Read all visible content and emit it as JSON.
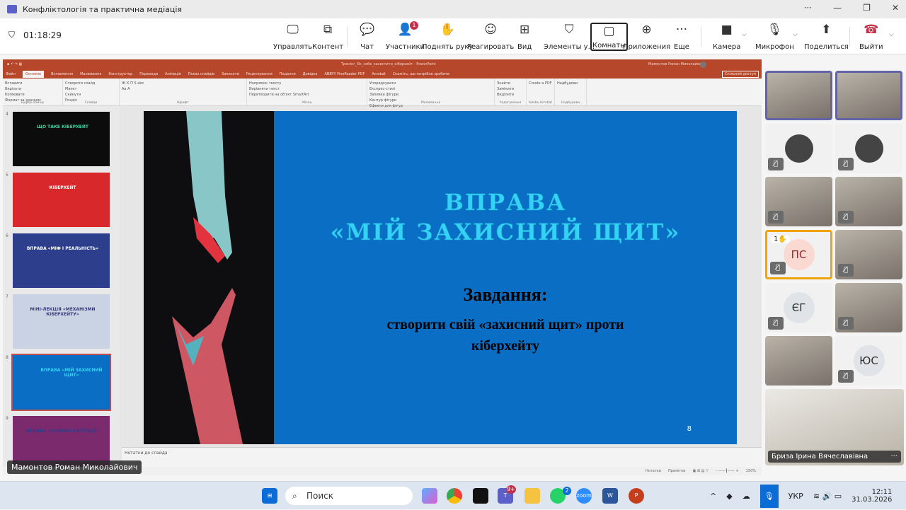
{
  "window": {
    "title": "Конфліктологія та практична медіація",
    "minimize": "—",
    "maximize": "❐",
    "close": "✕",
    "more": "···"
  },
  "meeting": {
    "timer": "01:18:29",
    "buttons": [
      {
        "label": "Управлять",
        "icon": "share-control-icon",
        "glyph": "🖵"
      },
      {
        "label": "Контент",
        "icon": "content-icon",
        "glyph": "⧉"
      },
      {
        "label": "Чат",
        "icon": "chat-icon",
        "glyph": "💬"
      },
      {
        "label": "Участники",
        "icon": "participants-icon",
        "glyph": "👤",
        "badge": "1"
      },
      {
        "label": "Поднять руку",
        "icon": "raise-hand-icon",
        "glyph": "✋"
      },
      {
        "label": "Реагировать",
        "icon": "react-icon",
        "glyph": "☺"
      },
      {
        "label": "Вид",
        "icon": "view-icon",
        "glyph": "⊞"
      },
      {
        "label": "Элементы у...",
        "icon": "shield-settings-icon",
        "glyph": "⛉"
      },
      {
        "label": "Комнаты",
        "icon": "rooms-icon",
        "glyph": "▢"
      },
      {
        "label": "Приложения",
        "icon": "apps-icon",
        "glyph": "⊕"
      },
      {
        "label": "Еще",
        "icon": "more-icon",
        "glyph": "···"
      },
      {
        "label": "Камера",
        "icon": "camera-icon",
        "glyph": "■"
      },
      {
        "label": "Микрофон",
        "icon": "microphone-icon",
        "glyph": "🎙"
      },
      {
        "label": "Поделиться",
        "icon": "share-icon",
        "glyph": "⬆"
      },
      {
        "label": "Выйти",
        "icon": "leave-icon",
        "glyph": "☎"
      }
    ]
  },
  "ppt": {
    "file_title": "Тренінг_Як_себе_захистити_кіберхейт - PowerPoint",
    "user": "Мамонтов Роман Миколайович",
    "share_label": "Спільний доступ",
    "tabs": [
      "Файл",
      "Основне",
      "Вставлення",
      "Малювання",
      "Конструктор",
      "Переходи",
      "Анімація",
      "Показ слайдів",
      "Записати",
      "Рецензування",
      "Подання",
      "Довідка",
      "ABBYY FineReader PDF",
      "Acrobat",
      "Скажіть, що потрібно зробити"
    ],
    "active_tab": "Основне",
    "groups": [
      {
        "label": "Буфер обміну",
        "items": [
          "Вставити",
          "Вирізати",
          "Копіювати",
          "Формат за зразком"
        ]
      },
      {
        "label": "Слайди",
        "items": [
          "Створити слайд",
          "Макет",
          "Скинути",
          "Розділ"
        ]
      },
      {
        "label": "Шрифт",
        "items": [
          "Ж К П S abc",
          "Аа A"
        ]
      },
      {
        "label": "Абзац",
        "items": [
          "Напрямок тексту",
          "Вирівняти текст",
          "Перетворити на об'єкт SmartArt"
        ]
      },
      {
        "label": "Малювання",
        "items": [
          "Упорядкувати",
          "Експрес-стилі",
          "Заливка фігури",
          "Контур фігури",
          "Ефекти для фігур"
        ]
      },
      {
        "label": "Редагування",
        "items": [
          "Знайти",
          "Замінити",
          "Виділити"
        ]
      },
      {
        "label": "Adobe Acrobat",
        "items": [
          "Create a PDF"
        ]
      },
      {
        "label": "Надбудови",
        "items": [
          "Надбудови"
        ]
      }
    ],
    "thumbnails": [
      {
        "num": "4",
        "title": "ЩО ТАКЕ КІБЕРХЕЙТ",
        "bg": "#0c0c0c",
        "fg": "#3fd4a5"
      },
      {
        "num": "5",
        "title": "КІБЕРХЕЙТ",
        "bg": "#d8282c",
        "fg": "#ffffff"
      },
      {
        "num": "6",
        "title": "ВПРАВА «МІФ І РЕАЛЬНІСТЬ»",
        "bg": "#2c3e8c",
        "fg": "#ffffff"
      },
      {
        "num": "7",
        "title": "МІНІ-ЛЕКЦІЯ «МЕХАНІЗМИ КІБЕРХЕЙТУ»",
        "bg": "#c9d3e3",
        "fg": "#3b3b7a"
      },
      {
        "num": "8",
        "title": "ВПРАВА «МІЙ ЗАХИСНИЙ ЩИТ»",
        "bg": "#0a6fc4",
        "fg": "#34d3f5",
        "selected": true
      },
      {
        "num": "9",
        "title": "ВПРАВА «РОЛЬОВІ СИТУАЦІЇ»",
        "bg": "#7b2a6e",
        "fg": "#2c3e8c"
      }
    ],
    "slide": {
      "title_line1": "ВПРАВА",
      "title_line2": "«МІЙ ЗАХИСНИЙ ЩИТ»",
      "task_heading": "Завдання:",
      "task_line1": "створити свій «захисний щит» проти",
      "task_line2": "кіберхейту",
      "number": "8",
      "bg": "#0a6fc4",
      "title_color": "#34d3f5"
    },
    "notes_placeholder": "Нотатки до слайда",
    "status": {
      "notes": "Нотатки",
      "comments": "Примітки",
      "zoom": "150%"
    },
    "presenter": "Мамонтов Роман Миколайович"
  },
  "participants": {
    "tiles": [
      {
        "type": "video",
        "speaking": true
      },
      {
        "type": "video",
        "speaking": true
      },
      {
        "type": "avatar",
        "muted": true
      },
      {
        "type": "avatar",
        "muted": true
      },
      {
        "type": "video",
        "muted": true
      },
      {
        "type": "video",
        "muted": true
      },
      {
        "type": "initials",
        "initials": "ПС",
        "hand": "1",
        "muted": true
      },
      {
        "type": "video",
        "muted": true
      },
      {
        "type": "initials",
        "initials": "ЄГ",
        "muted": true
      },
      {
        "type": "video",
        "muted": true
      },
      {
        "type": "video"
      },
      {
        "type": "initials",
        "initials": "ЮС",
        "muted": true
      }
    ],
    "featured": {
      "name": "Бриза Ірина Вячеславівна",
      "more": "···"
    }
  },
  "taskbar": {
    "search_placeholder": "Поиск",
    "teams_badge": "9+",
    "whatsapp_badge": "2",
    "language": "УКР",
    "time": "12:11",
    "date": "31.03.2026"
  }
}
